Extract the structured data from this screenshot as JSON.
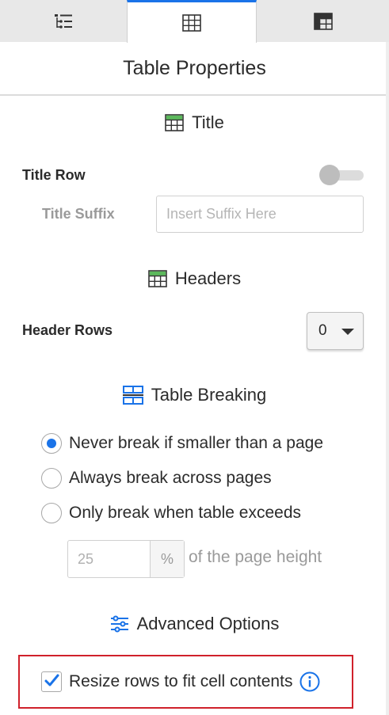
{
  "tabs": [
    {
      "name": "outline",
      "icon": "list-tree-icon",
      "active": false
    },
    {
      "name": "table",
      "icon": "table-grid-icon",
      "active": true
    },
    {
      "name": "table-style",
      "icon": "table-dark-icon",
      "active": false
    }
  ],
  "panel": {
    "title": "Table Properties"
  },
  "title_section": {
    "heading": "Title",
    "title_row_label": "Title Row",
    "title_row_enabled": false,
    "title_suffix_label": "Title Suffix",
    "title_suffix_placeholder": "Insert Suffix Here",
    "title_suffix_value": ""
  },
  "headers_section": {
    "heading": "Headers",
    "header_rows_label": "Header Rows",
    "header_rows_value": "0"
  },
  "breaking_section": {
    "heading": "Table Breaking",
    "options": [
      {
        "label": "Never break if smaller than a page",
        "selected": true
      },
      {
        "label": "Always break across pages",
        "selected": false
      },
      {
        "label": "Only break when table exceeds",
        "selected": false
      }
    ],
    "threshold_placeholder": "25",
    "threshold_unit": "%",
    "threshold_suffix": "of the page height"
  },
  "advanced_section": {
    "heading": "Advanced Options",
    "resize_rows_label": "Resize rows to fit cell contents",
    "resize_rows_checked": true
  },
  "colors": {
    "accent": "#1a73e8",
    "icon_green": "#5cb85c",
    "highlight_border": "#d0212b"
  }
}
